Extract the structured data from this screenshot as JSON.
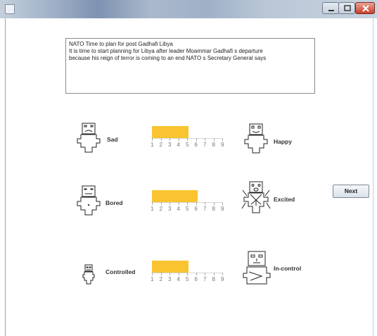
{
  "window": {
    "icons": {
      "app": "java-app-icon",
      "minimize": "minimize-icon",
      "maximize": "maximize-icon",
      "close": "close-icon"
    }
  },
  "article": {
    "lines": [
      "NATO Time to plan for post Gadhafi Libya",
      "It is time to start planning for Libya after leader Moammar Gadhafi s departure",
      "because his reign of terror is coming to an end NATO s Secretary General says"
    ]
  },
  "scale_numbers": [
    "1",
    "2",
    "3",
    "4",
    "5",
    "6",
    "7",
    "8",
    "9"
  ],
  "rows": [
    {
      "left": "Sad",
      "right": "Happy",
      "value": 5,
      "left_icon": "sad-figure-icon",
      "right_icon": "happy-figure-icon"
    },
    {
      "left": "Bored",
      "right": "Excited",
      "value": 6,
      "left_icon": "bored-figure-icon",
      "right_icon": "excited-figure-icon"
    },
    {
      "left": "Controlled",
      "right": "In-control",
      "value": 5,
      "left_icon": "controlled-figure-icon",
      "right_icon": "in-control-figure-icon"
    }
  ],
  "next_button": {
    "label": "Next"
  },
  "colors": {
    "fill": "#f9c42f",
    "close_button": "#c9402a"
  }
}
